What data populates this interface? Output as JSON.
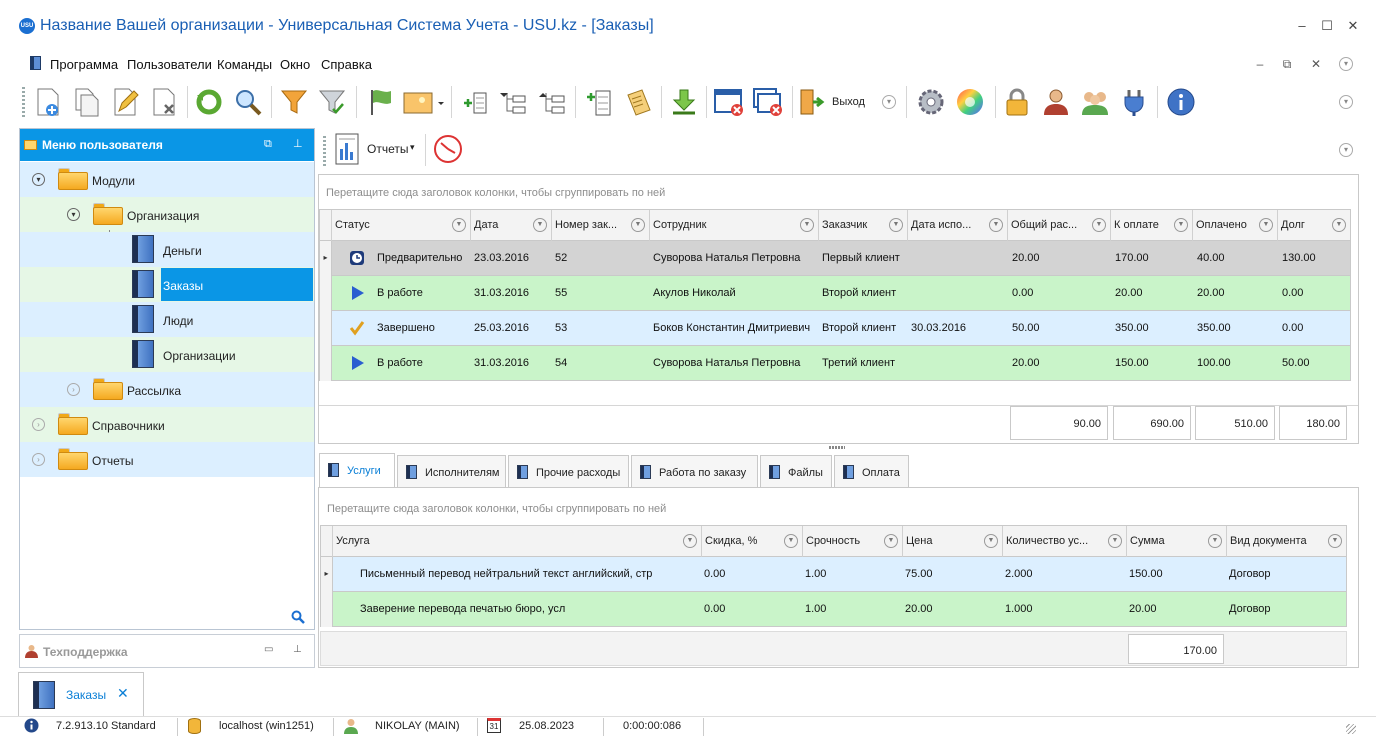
{
  "window": {
    "title": "Название Вашей организации - Универсальная Система Учета - USU.kz - [Заказы]",
    "logo_text": "USU",
    "controls": [
      "–",
      "☐",
      "✕"
    ]
  },
  "menu": {
    "items": [
      "Программа",
      "Пользователи",
      "Команды",
      "Окно",
      "Справка"
    ],
    "mdi_controls": [
      "–",
      "⧉",
      "✕"
    ]
  },
  "toolbar": {
    "exit_label": "Выход"
  },
  "nav": {
    "title": "Меню пользователя",
    "tree": {
      "modules": "Модули",
      "organization": "Организация",
      "money": "Деньги",
      "orders": "Заказы",
      "people": "Люди",
      "organizations": "Организации",
      "mailing": "Рассылка",
      "references": "Справочники",
      "reports": "Отчеты"
    }
  },
  "support": {
    "title": "Техподдержка"
  },
  "reports_bar": {
    "reports_label": "Отчеты"
  },
  "orders_grid": {
    "group_hint": "Перетащите сюда заголовок колонки, чтобы сгруппировать по ней",
    "columns": [
      "Статус",
      "Дата",
      "Номер зак...",
      "Сотрудник",
      "Заказчик",
      "Дата испо...",
      "Общий рас...",
      "К оплате",
      "Оплачено",
      "Долг"
    ],
    "rows": [
      {
        "status": "Предварительно",
        "date": "23.03.2016",
        "number": "52",
        "employee": "Суворова Наталья Петровна",
        "customer": "Первый клиент",
        "exec_date": "",
        "total": "20.00",
        "to_pay": "170.00",
        "paid": "40.00",
        "debt": "130.00",
        "icon": "clock-icon",
        "bg": "#d3d3d3"
      },
      {
        "status": "В работе",
        "date": "31.03.2016",
        "number": "55",
        "employee": "Акулов Николай",
        "customer": "Второй клиент",
        "exec_date": "",
        "total": "0.00",
        "to_pay": "20.00",
        "paid": "20.00",
        "debt": "0.00",
        "icon": "play-icon",
        "bg": "#c9f4c9"
      },
      {
        "status": "Завершено",
        "date": "25.03.2016",
        "number": "53",
        "employee": "Боков Константин Дмитриевич",
        "customer": "Второй клиент",
        "exec_date": "30.03.2016",
        "total": "50.00",
        "to_pay": "350.00",
        "paid": "350.00",
        "debt": "0.00",
        "icon": "check-icon",
        "bg": "#dcefff"
      },
      {
        "status": "В работе",
        "date": "31.03.2016",
        "number": "54",
        "employee": "Суворова Наталья Петровна",
        "customer": "Третий клиент",
        "exec_date": "",
        "total": "20.00",
        "to_pay": "150.00",
        "paid": "100.00",
        "debt": "50.00",
        "icon": "play-icon",
        "bg": "#c9f4c9"
      }
    ],
    "totals": [
      "90.00",
      "690.00",
      "510.00",
      "180.00"
    ]
  },
  "tabs": [
    "Услуги",
    "Исполнителям",
    "Прочие расходы",
    "Работа по заказу",
    "Файлы",
    "Оплата"
  ],
  "services_grid": {
    "group_hint": "Перетащите сюда заголовок колонки, чтобы сгруппировать по ней",
    "columns": [
      "Услуга",
      "Скидка, %",
      "Срочность",
      "Цена",
      "Количество ус...",
      "Сумма",
      "Вид документа"
    ],
    "rows": [
      {
        "service": "Письменный перевод нейтральний текст английский, стр",
        "discount": "0.00",
        "urgency": "1.00",
        "price": "75.00",
        "qty": "2.000",
        "sum": "150.00",
        "doc": "Договор",
        "bg": "#dcefff"
      },
      {
        "service": "Заверение перевода печатью бюро, усл",
        "discount": "0.00",
        "urgency": "1.00",
        "price": "20.00",
        "qty": "1.000",
        "sum": "20.00",
        "doc": "Договор",
        "bg": "#c9f4c9"
      }
    ],
    "total": "170.00"
  },
  "doc_tab": {
    "label": "Заказы"
  },
  "status": {
    "version": "7.2.913.10 Standard",
    "server": "localhost (win1251)",
    "user": "NIKOLAY (MAIN)",
    "calendar_day": "31",
    "date": "25.08.2023",
    "timer": "0:00:00:086"
  }
}
